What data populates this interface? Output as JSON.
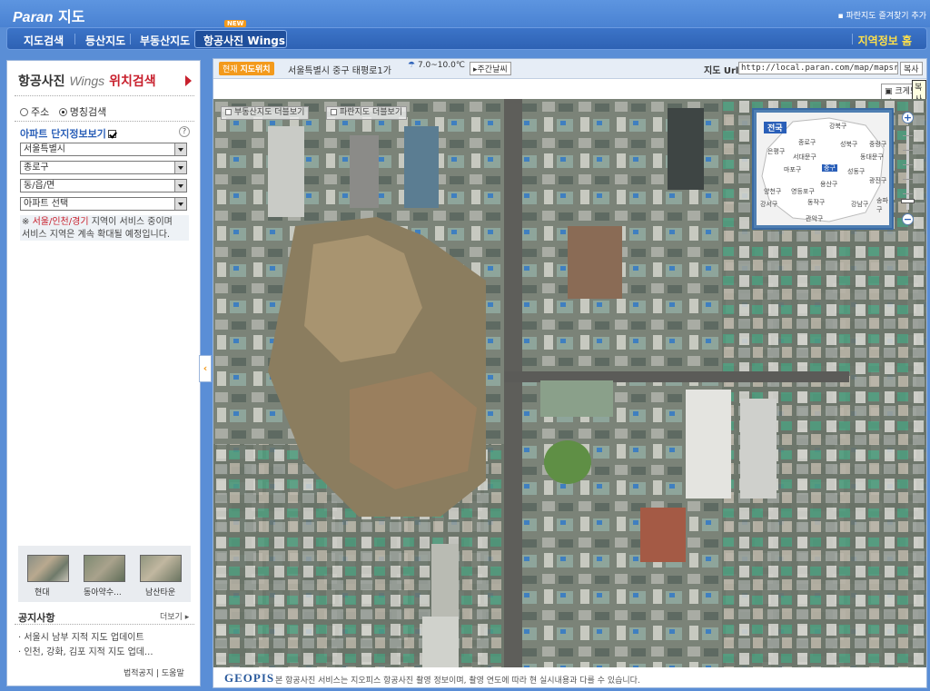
{
  "header": {
    "logo_brand": "Paran",
    "logo_service": "지도",
    "favorites": "파란지도 즐겨찾기 추가"
  },
  "nav": {
    "items": [
      "지도검색",
      "등산지도",
      "부동산지도",
      "항공사진 Wings"
    ],
    "new_badge": "NEW",
    "region_home": "지역정보 홈"
  },
  "left": {
    "title_main": "항공사진",
    "title_wings": "Wings",
    "title_search": "위치검색",
    "radio_address": "주소",
    "radio_name": "명칭검색",
    "apt_label": "아파트 단지정보보기",
    "help": "?",
    "selects": [
      "서울특별시",
      "종로구",
      "동/읍/면",
      "아파트 선택"
    ],
    "notice_mark": "※",
    "notice_highlight": "서울/인천/경기",
    "notice_rest1": " 지역이 서비스 중이며",
    "notice_line2": "서비스 지역은 계속 확대될 예정입니다.",
    "thumbs": [
      "현대",
      "동아약수...",
      "남산타운"
    ],
    "announce_title": "공지사항",
    "announce_more": "더보기",
    "announcements": [
      "· 서울시 남부 지적 지도 업데이트",
      "· 인천, 강화, 김포 지적 지도 업데..."
    ],
    "footer_legal": "법적공지",
    "footer_help": "도움말"
  },
  "map": {
    "current_loc_label": "현재",
    "current_loc_strong": "지도위치",
    "address": "서울특별시 중구 태평로1가",
    "weather": "7.0~10.0℃",
    "weekly_weather": "주간날씨",
    "url_label": "지도 Url",
    "url_value": "http://local.paran.com/map/mapsrch_w",
    "copy_button": "복사",
    "bigger_button": "크게보기",
    "tooltip": "복사",
    "layer_realty": "부동산지도 더블보기",
    "layer_paran": "파란지도 더블보기",
    "overview_tag": "전국",
    "overview_districts": [
      "강북구",
      "종로구",
      "성북구",
      "중랑구",
      "은평구",
      "동대문구",
      "서대문구",
      "마포구",
      "중구",
      "성동구",
      "광진구",
      "용산구",
      "양천구",
      "영등포구",
      "강서구",
      "동작구",
      "강남구",
      "송파구",
      "관악구"
    ],
    "overview_highlight": "중구",
    "geopis": "GEOPIS",
    "credit": "본 항공사진 서비스는 지오피스 항공사진 촬영 정보이며, 촬영 연도에 따라 현 실시내용과 다를 수 있습니다."
  },
  "colors": {
    "accent_blue": "#2a5fb8",
    "brand_red": "#c8202d",
    "badge_orange": "#f39a1c"
  }
}
